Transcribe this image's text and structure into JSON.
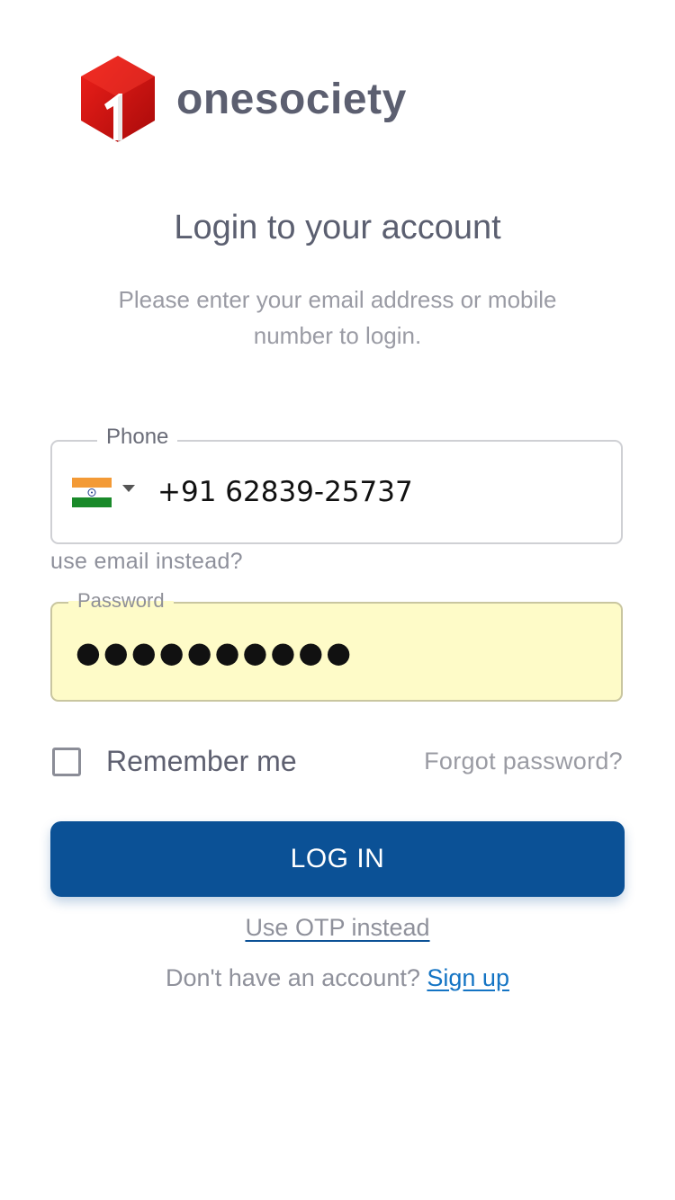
{
  "brand": {
    "name": "onesociety",
    "logo_icon": "red-hexagon-1-logo",
    "logo_color": "#d0100f"
  },
  "header": {
    "title": "Login to your account",
    "subtitle": "Please enter your email address or mobile number to login."
  },
  "form": {
    "phone": {
      "label": "Phone",
      "country_flag": "india-flag-icon",
      "value": "+91 62839-25737"
    },
    "use_email_link": "use email instead?",
    "password": {
      "label": "Password",
      "value_masked": "●●●●●●●●●●"
    },
    "remember_me": {
      "label": "Remember me",
      "checked": false
    },
    "forgot_link": "Forgot password?",
    "login_button": "LOG IN",
    "otp_link": "Use OTP instead",
    "signup_prompt": "Don't have an account?",
    "signup_link": "Sign up"
  },
  "colors": {
    "primary": "#0b5196",
    "link": "#1474c4",
    "autofill": "#fefbc8"
  }
}
